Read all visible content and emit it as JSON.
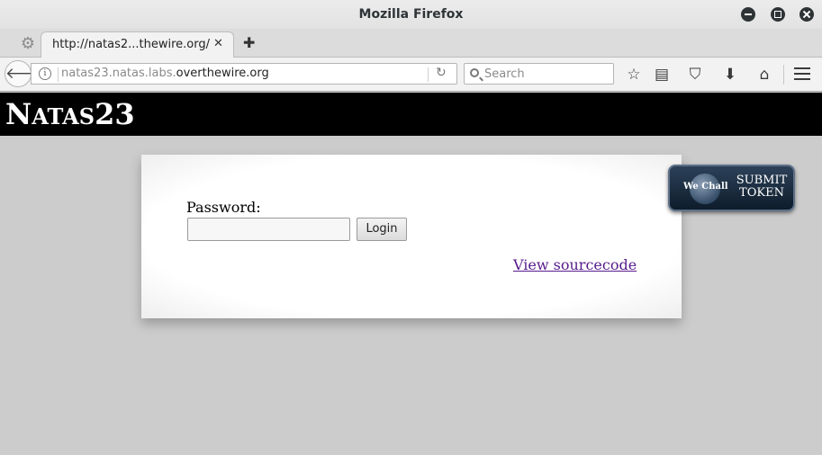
{
  "window": {
    "title": "Mozilla Firefox"
  },
  "tabs": [
    {
      "title": "http://natas2...thewire.org/"
    }
  ],
  "navbar": {
    "url_prefix": "natas23.natas.labs.",
    "url_domain": "overthewire.org",
    "search_placeholder": "Search"
  },
  "page": {
    "logo_big": "N",
    "logo_small": "ATAS",
    "logo_num": "23",
    "password_label": "Password:",
    "password_value": "",
    "login_label": "Login",
    "source_link": "View sourcecode",
    "wechall_logo": "We Chall",
    "submit_line1": "SUBMIT",
    "submit_line2": "TOKEN"
  },
  "colors": {
    "header_bg": "#000000",
    "page_bg": "#cccccc",
    "link_visited": "#551a8b"
  },
  "icons": [
    "gear-icon",
    "back-icon",
    "info-icon",
    "reload-icon",
    "search-icon",
    "bookmark-star-icon",
    "reading-list-icon",
    "pocket-icon",
    "download-icon",
    "home-icon",
    "hamburger-menu-icon"
  ]
}
